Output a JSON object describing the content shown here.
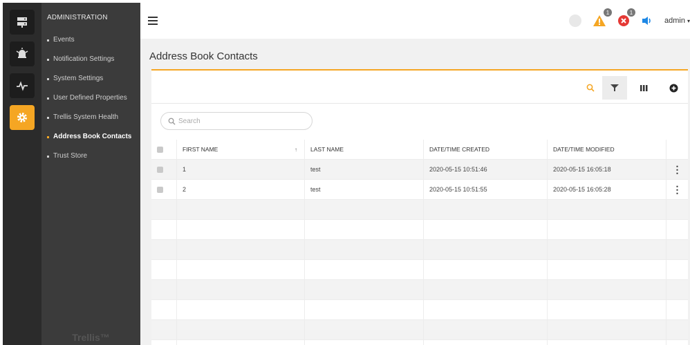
{
  "rail": {
    "items": [
      {
        "name": "server-icon"
      },
      {
        "name": "alarm-icon"
      },
      {
        "name": "pulse-icon"
      },
      {
        "name": "gear-icon",
        "active": true
      }
    ]
  },
  "subnav": {
    "title": "ADMINISTRATION",
    "items": [
      {
        "label": "Events"
      },
      {
        "label": "Notification Settings"
      },
      {
        "label": "System Settings"
      },
      {
        "label": "User Defined Properties"
      },
      {
        "label": "Trellis System Health"
      },
      {
        "label": "Address Book Contacts",
        "active": true
      },
      {
        "label": "Trust Store"
      }
    ],
    "brand": "Trellis™"
  },
  "topbar": {
    "warning_count": "1",
    "error_count": "1",
    "user": "admin",
    "colors": {
      "warning": "#f5a623",
      "error": "#e53935",
      "sound": "#1e88e5"
    }
  },
  "page": {
    "title": "Address Book Contacts"
  },
  "search": {
    "placeholder": "Search"
  },
  "table": {
    "columns": [
      "FIRST NAME",
      "LAST NAME",
      "DATE/TIME CREATED",
      "DATE/TIME MODIFIED"
    ],
    "sort_indicator": "↑",
    "rows": [
      {
        "first": "1",
        "last": "test",
        "created": "2020-05-15 10:51:46",
        "modified": "2020-05-15 16:05:18"
      },
      {
        "first": "2",
        "last": "test",
        "created": "2020-05-15 10:51:55",
        "modified": "2020-05-15 16:05:28"
      }
    ]
  },
  "colors": {
    "accent": "#f5a623",
    "rail_bg": "#2b2b2b",
    "subnav_bg": "#3b3b3b"
  }
}
